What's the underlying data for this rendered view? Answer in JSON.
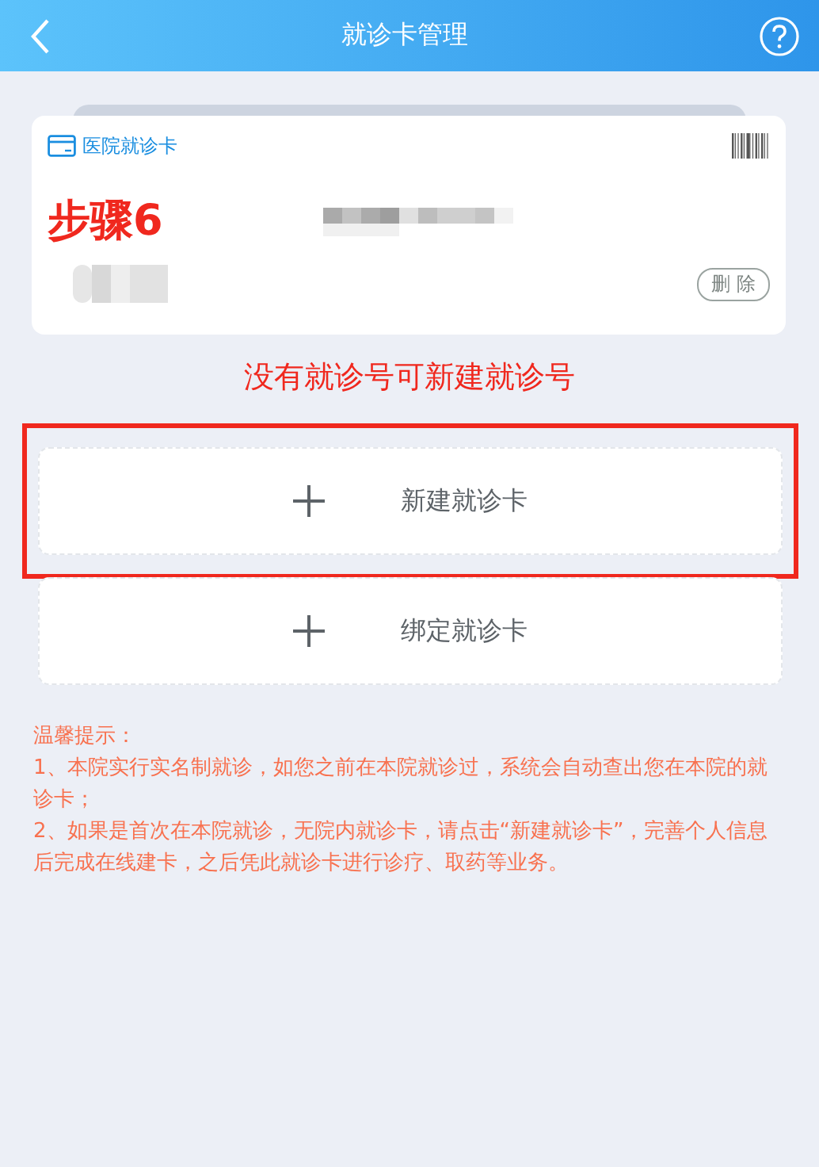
{
  "header": {
    "title": "就诊卡管理"
  },
  "card": {
    "label": "医院就诊卡",
    "delete_button": "删 除"
  },
  "annotation_step": "步骤6",
  "annotation_note": "没有就诊号可新建就诊号",
  "actions": [
    {
      "label": "新建就诊卡",
      "highlighted": true
    },
    {
      "label": "绑定就诊卡",
      "highlighted": false
    }
  ],
  "tips": {
    "title": "温馨提示：",
    "items": [
      "1、本院实行实名制就诊，如您之前在本院就诊过，系统会自动查出您在本院的就诊卡；",
      "2、如果是首次在本院就诊，无院内就诊卡，请点击“新建就诊卡”，完善个人信息后完成在线建卡，之后凭此就诊卡进行诊疗、取药等业务。"
    ]
  }
}
